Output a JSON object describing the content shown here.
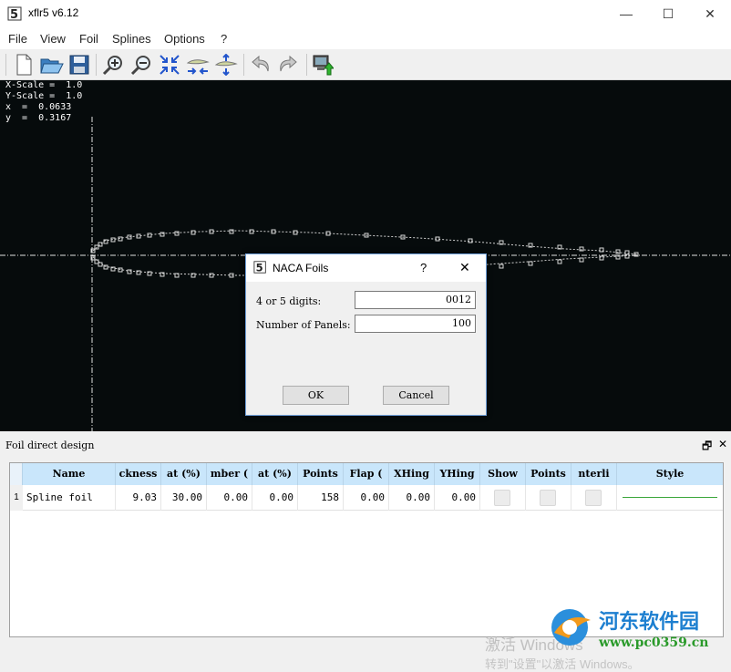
{
  "window": {
    "title": "xflr5 v6.12",
    "minimize": "—",
    "maximize": "☐",
    "close": "✕"
  },
  "menu": [
    "File",
    "View",
    "Foil",
    "Splines",
    "Options",
    "?"
  ],
  "toolbar": [
    {
      "name": "new-document-icon"
    },
    {
      "name": "open-folder-icon"
    },
    {
      "name": "save-icon"
    },
    {
      "name": "zoom-in-icon"
    },
    {
      "name": "zoom-out-icon"
    },
    {
      "name": "reset-scale-icon"
    },
    {
      "name": "reset-x-scale-icon"
    },
    {
      "name": "reset-y-scale-icon"
    },
    {
      "name": "undo-icon"
    },
    {
      "name": "redo-icon"
    },
    {
      "name": "export-image-icon"
    }
  ],
  "readout": {
    "xscale": "X-Scale =  1.0",
    "yscale": "Y-Scale =  1.0",
    "x": "x  =  0.0633",
    "y": "y  =  0.3167"
  },
  "dock": {
    "title": "Foil direct design",
    "restore": "🗗",
    "close": "✕"
  },
  "table": {
    "headers": [
      "Name",
      "ckness",
      "at (%)",
      "mber (",
      "at (%)",
      "Points",
      "Flap (",
      "XHing",
      "YHing",
      "Show",
      "Points",
      "nterli",
      "Style"
    ],
    "row": {
      "index": "1",
      "name": "Spline foil",
      "thickness": "9.03",
      "thickness_at": "30.00",
      "camber": "0.00",
      "camber_at": "0.00",
      "points": "158",
      "flap": "0.00",
      "xhinge": "0.00",
      "yhinge": "0.00",
      "style_color": "#3aa63a"
    }
  },
  "dialog": {
    "title": "NACA Foils",
    "help": "?",
    "close": "✕",
    "digits_label": "4 or 5 digits:",
    "digits_value": "0012",
    "panels_label": "Number of Panels:",
    "panels_value": "100",
    "ok": "OK",
    "cancel": "Cancel"
  },
  "watermark": {
    "line1": "激活 Windows",
    "line2": "转到\"设置\"以激活 Windows。",
    "brand_name": "河东软件园",
    "brand_url": "www.pc0359.cn"
  },
  "colors": {
    "canvas": "#060b0c",
    "foil": "#cfcfcf",
    "header": "#c9e6fb",
    "accent": "#1d7fd0"
  }
}
